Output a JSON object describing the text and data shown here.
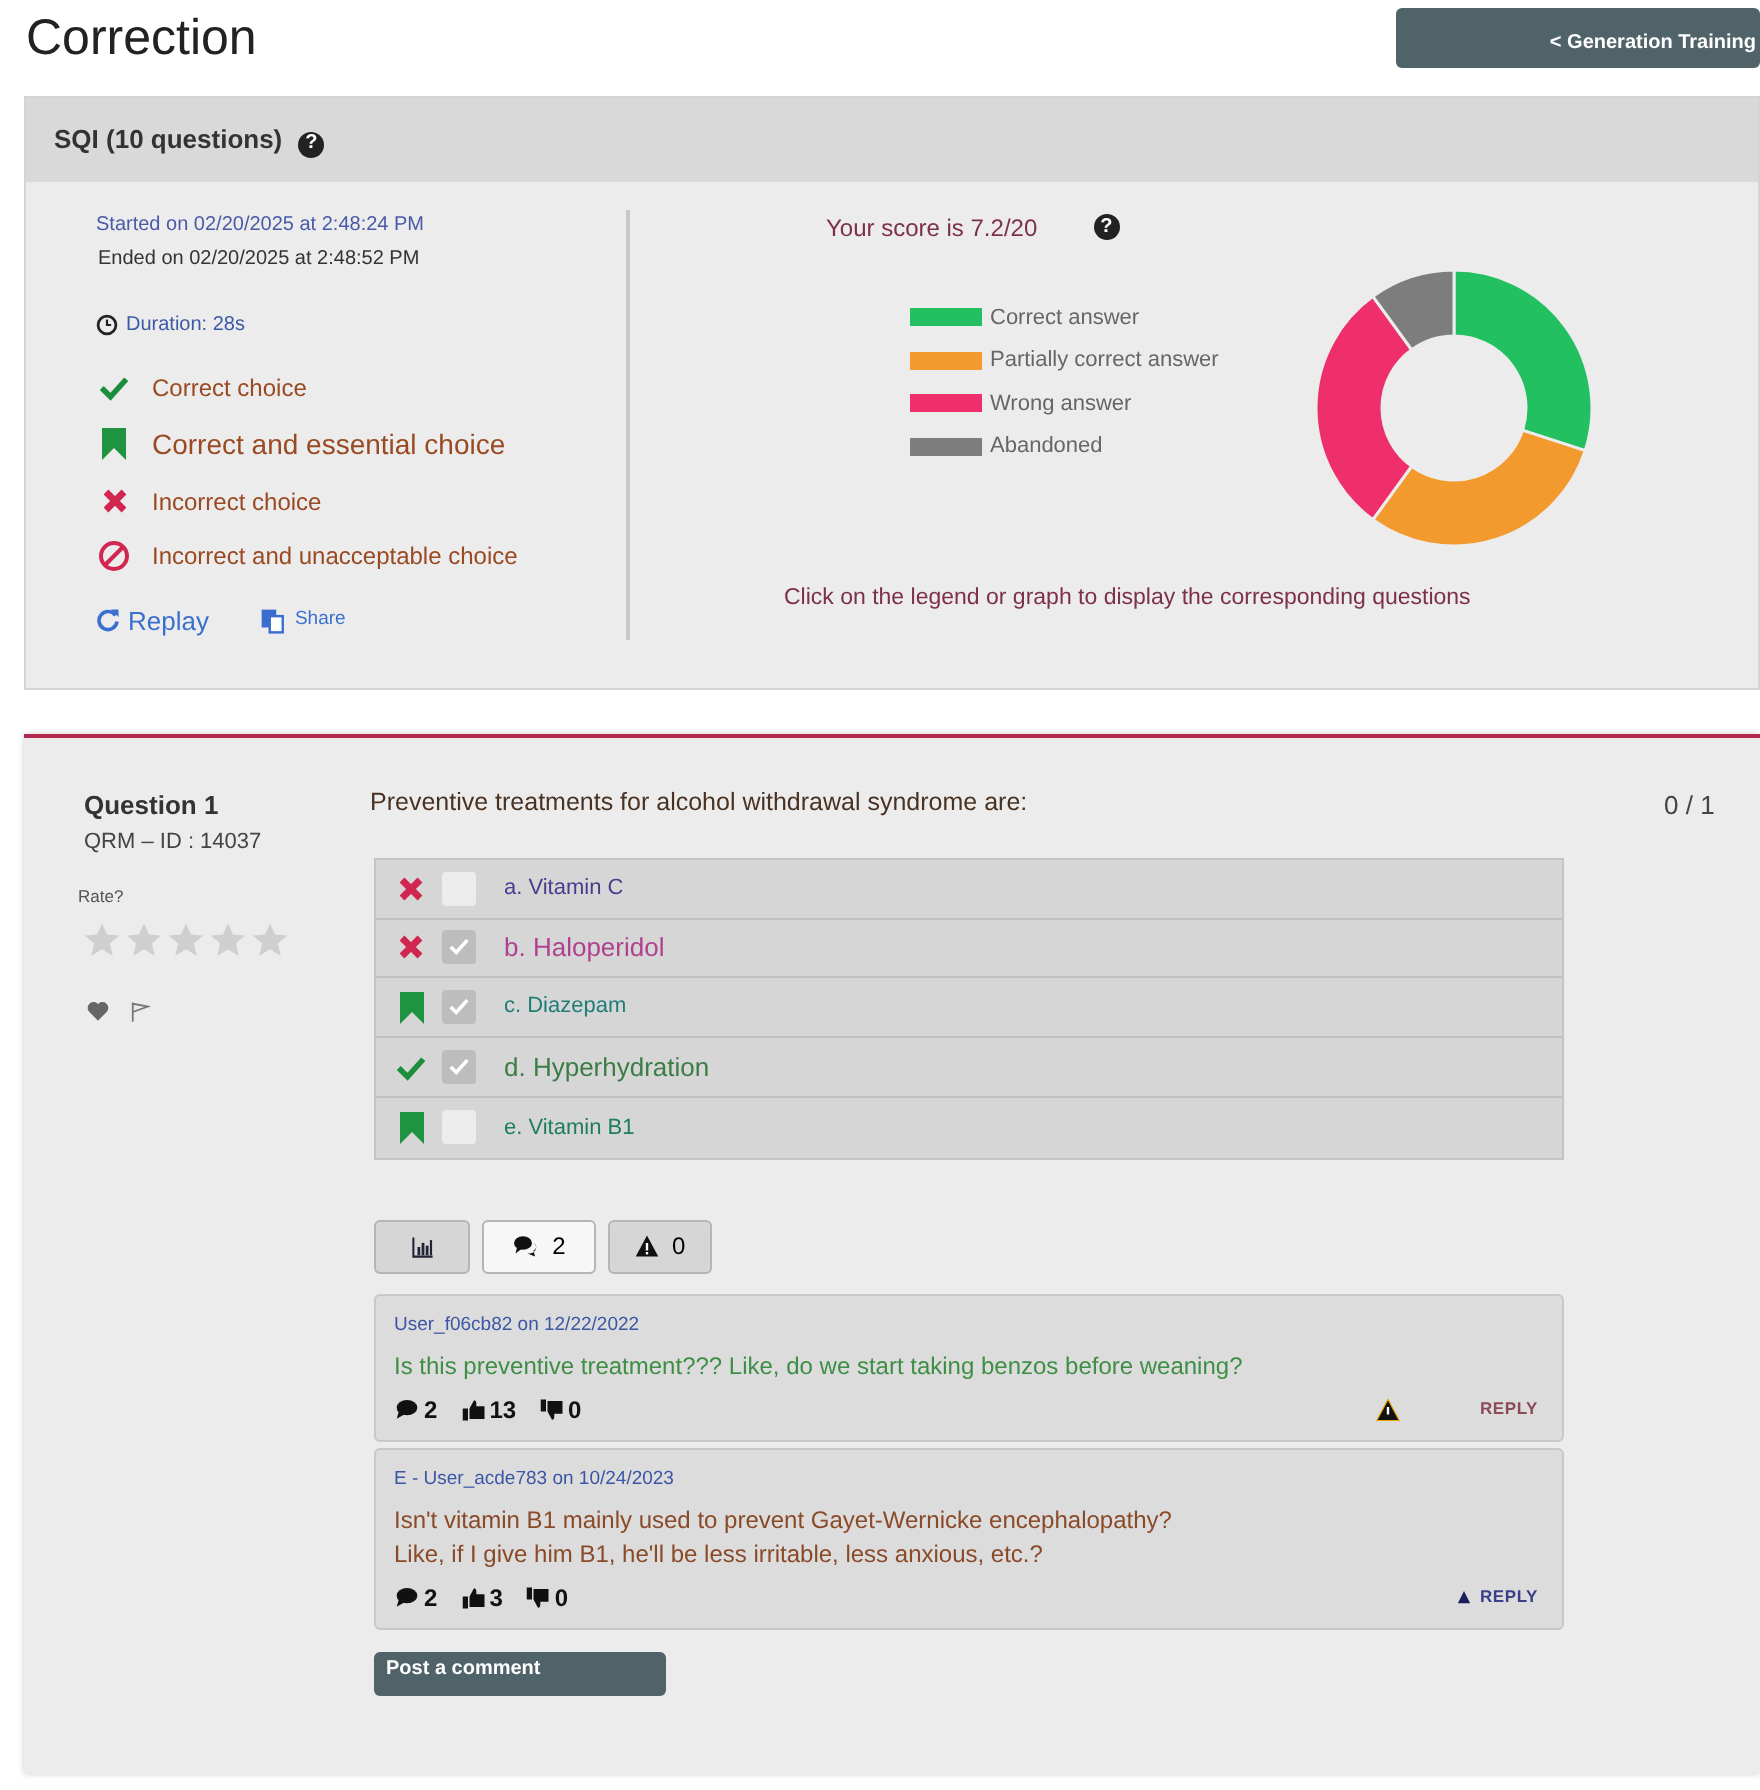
{
  "page_title": "Correction",
  "back_button": "< Generation Training",
  "summary": {
    "title": "SQI (10 questions)",
    "started": "Started on 02/20/2025 at 2:48:24 PM",
    "ended": "Ended on 02/20/2025 at 2:48:52 PM",
    "duration": "Duration: 28s",
    "key": [
      {
        "kind": "correct",
        "label": "Correct choice"
      },
      {
        "kind": "essential",
        "label": "Correct and essential choice"
      },
      {
        "kind": "incorrect",
        "label": "Incorrect choice"
      },
      {
        "kind": "unacceptable",
        "label": "Incorrect and unacceptable choice"
      }
    ],
    "help_mark": "?",
    "score_help_mark": "?",
    "replay": "Replay",
    "share": "Share",
    "score": "Your score is 7.2/20",
    "legend": [
      {
        "label": "Correct answer",
        "color": "#22c060"
      },
      {
        "label": "Partially correct answer",
        "color": "#f39a2e"
      },
      {
        "label": "Wrong answer",
        "color": "#ee2f6c"
      },
      {
        "label": "Abandoned",
        "color": "#7d7d7d"
      }
    ],
    "hint": "Click on the legend or graph to display the corresponding questions"
  },
  "question": {
    "title": "Question 1",
    "id": "QRM – ID : 14037",
    "rate_label": "Rate?",
    "stars": 0,
    "text": "Preventive treatments for alcohol withdrawal syndrome are:",
    "score": "0 / 1",
    "answers": [
      {
        "kind": "incorrect",
        "checked": false,
        "label": "a. Vitamin C",
        "color": "#4a3b8c"
      },
      {
        "kind": "incorrect",
        "checked": true,
        "label": "b. Haloperidol",
        "color": "#b0418f"
      },
      {
        "kind": "essential",
        "checked": true,
        "label": "c. Diazepam",
        "color": "#1f7d78"
      },
      {
        "kind": "correct",
        "checked": true,
        "label": "d. Hyperhydration",
        "color": "#3c7d45"
      },
      {
        "kind": "essential",
        "checked": false,
        "label": "e. Vitamin B1",
        "color": "#1f7d5a"
      }
    ],
    "tabs": [
      {
        "kind": "stats",
        "selected": false
      },
      {
        "kind": "comments",
        "label": "2",
        "selected": true
      },
      {
        "kind": "reports",
        "label": "0",
        "selected": false
      }
    ],
    "comments": [
      {
        "byline": "User_f06cb82 on 12/22/2022",
        "text": "Is this preventive treatment??? Like, do we start taking benzos before weaning?",
        "color": "#3e8f45",
        "replies": "2",
        "likes": "13",
        "dislikes": "0",
        "report": true,
        "reply": "REPLY",
        "expanded": false
      },
      {
        "byline": "E - User_acde783 on 10/24/2023",
        "text": "Isn't vitamin B1 mainly used to prevent Gayet-Wernicke encephalopathy?\nLike, if I give him B1, he'll be less irritable, less anxious, etc.?",
        "color": "#8a4a28",
        "replies": "2",
        "likes": "3",
        "dislikes": "0",
        "report": false,
        "reply": "REPLY",
        "expanded": true
      }
    ],
    "post_button": "Post a comment"
  }
}
